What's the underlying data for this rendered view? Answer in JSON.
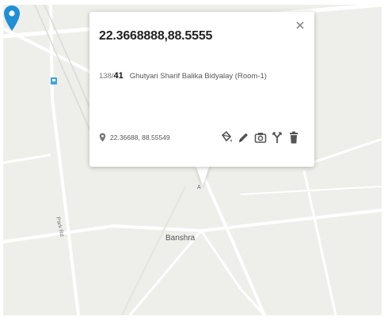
{
  "popup": {
    "title_coords": "22.3668888,88.5555",
    "address_num_a": "138/",
    "address_num_b": "41",
    "address_place": "Ghutyari Sharif Balika Bidyalay (Room-1)",
    "position_text": "22.36688, 88.55549"
  },
  "map": {
    "place_label": "Banshra",
    "road_label": "Park Rd",
    "small_label": "A"
  },
  "colors": {
    "marker": "#1f8fd6",
    "map_bg": "#eeeeea",
    "road": "#ffffff",
    "transit": "#3aa7d8"
  },
  "icons": {
    "close": "close-icon",
    "position": "location-pin-icon",
    "fill": "paint-bucket-icon",
    "edit": "pencil-icon",
    "photo": "camera-icon",
    "route": "route-fork-icon",
    "delete": "trash-icon",
    "marker": "map-marker-icon"
  }
}
